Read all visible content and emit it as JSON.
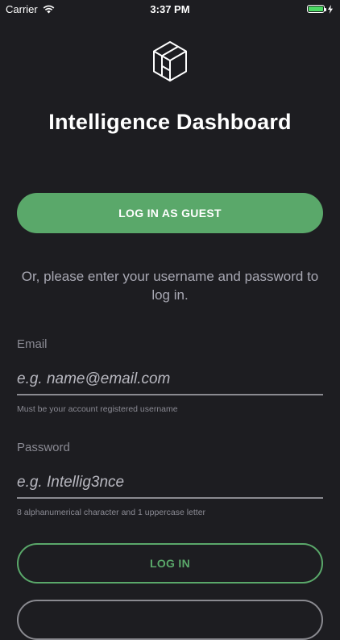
{
  "status_bar": {
    "carrier": "Carrier",
    "time": "3:37 PM",
    "battery_level": 1.0,
    "battery_color": "#4cd964",
    "icons": [
      "wifi-icon",
      "battery-icon",
      "charging-bolt-icon"
    ]
  },
  "app": {
    "logo_icon": "hexagon-cube-icon",
    "title": "Intelligence Dashboard"
  },
  "guest_button": {
    "label": "LOG IN AS GUEST",
    "color": "#5aa86a"
  },
  "instructions": "Or, please enter your username and password to log in.",
  "email": {
    "label": "Email",
    "placeholder": "e.g. name@email.com",
    "value": "",
    "hint": "Must be your account registered username"
  },
  "password": {
    "label": "Password",
    "placeholder": "e.g. Intellig3nce",
    "value": "",
    "hint": "8 alphanumerical character and 1 uppercase letter"
  },
  "login_button": {
    "label": "LOG IN",
    "color": "#5aa86a"
  },
  "colors": {
    "background": "#1d1d21",
    "accent": "#5aa86a",
    "muted_text": "#8a8a93"
  }
}
